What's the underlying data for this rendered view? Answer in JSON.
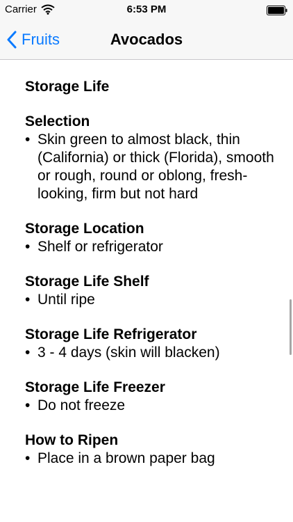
{
  "status_bar": {
    "carrier": "Carrier",
    "time": "6:53 PM"
  },
  "nav": {
    "back_label": "Fruits",
    "title": "Avocados",
    "accent_color": "#0a7aff"
  },
  "content": {
    "page_heading": "Storage Life",
    "sections": [
      {
        "heading": "Selection",
        "text": "Skin green to almost black, thin (California) or thick (Florida), smooth or rough, round or oblong, fresh-looking, firm but not hard"
      },
      {
        "heading": "Storage Location",
        "text": "Shelf or refrigerator"
      },
      {
        "heading": "Storage Life Shelf",
        "text": "Until ripe"
      },
      {
        "heading": "Storage Life Refrigerator",
        "text": "3 - 4 days (skin will blacken)"
      },
      {
        "heading": "Storage Life Freezer",
        "text": "Do not freeze"
      },
      {
        "heading": "How to Ripen",
        "text": "Place in a brown paper bag"
      }
    ]
  }
}
